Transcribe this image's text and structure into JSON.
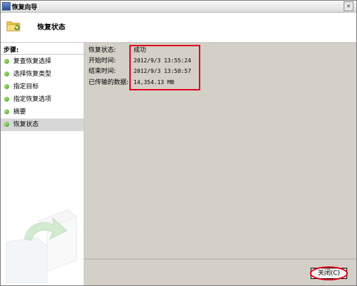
{
  "window": {
    "title": "恢复向导",
    "close_glyph": "×"
  },
  "header": {
    "title": "恢复状态",
    "icon": "folder-icon"
  },
  "sidebar": {
    "steps_label": "步骤:",
    "items": [
      {
        "label": "复查恢复选择"
      },
      {
        "label": "选择恢复类型"
      },
      {
        "label": "指定目标"
      },
      {
        "label": "指定恢复选项"
      },
      {
        "label": "摘要"
      },
      {
        "label": "恢复状态",
        "active": true
      }
    ]
  },
  "status": {
    "status_key": "恢复状态:",
    "status_value": "成功",
    "start_key": "开始时间:",
    "start_value": "2012/9/3 13:55:24",
    "end_key": "结束时间:",
    "end_value": "2012/9/3 13:58:57",
    "transferred_key": "已传输的数据:",
    "transferred_value": "14,354.13 MB"
  },
  "footer": {
    "close_label": "关闭(C)"
  },
  "colors": {
    "highlight": "#e0001a",
    "panel": "#d4d0c8",
    "active_item": "#d7d7d7"
  }
}
